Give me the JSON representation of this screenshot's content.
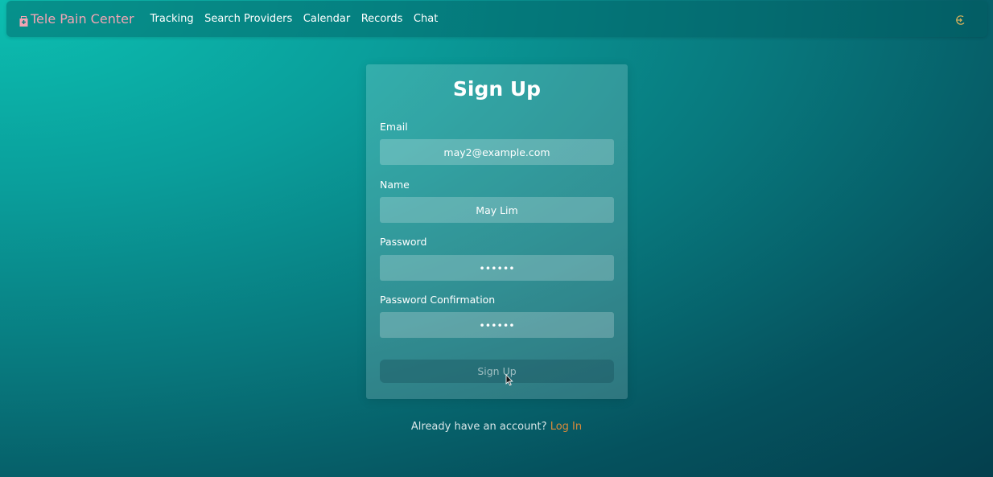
{
  "navbar": {
    "brand": "Tele Pain Center",
    "links": [
      "Tracking",
      "Search Providers",
      "Calendar",
      "Records",
      "Chat"
    ],
    "logout_icon": "logout-icon"
  },
  "form": {
    "title": "Sign Up",
    "email": {
      "label": "Email",
      "value": "may2@example.com"
    },
    "name": {
      "label": "Name",
      "value": "May Lim"
    },
    "password": {
      "label": "Password",
      "value": "••••••"
    },
    "password_confirmation": {
      "label": "Password Confirmation",
      "value": "••••••"
    },
    "submit_label": "Sign Up"
  },
  "footer": {
    "prompt": "Already have an account?",
    "link": "Log In"
  },
  "colors": {
    "brand": "#f2a4b4",
    "link": "#d98a3a",
    "icon_accent": "#e0b45a"
  }
}
